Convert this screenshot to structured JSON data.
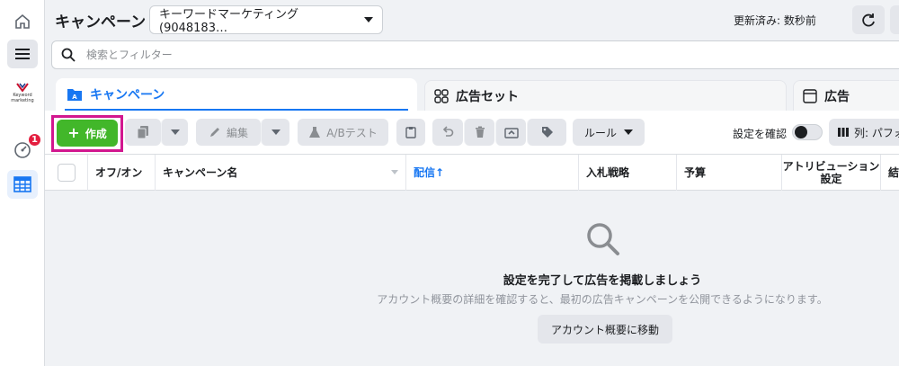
{
  "header": {
    "title": "キャンペーン",
    "account_select": "キーワードマーケティング (9048183…",
    "updated": "更新済み: 数秒前"
  },
  "search": {
    "placeholder": "検索とフィルター"
  },
  "rail": {
    "logo_text_1": "Keyword",
    "logo_text_2": "marketing",
    "notification_count": "1"
  },
  "tabs": [
    {
      "label": "キャンペーン",
      "icon": "folder-icon",
      "active": true
    },
    {
      "label": "広告セット",
      "icon": "grid-icon",
      "active": false
    },
    {
      "label": "広告",
      "icon": "ad-window-icon",
      "active": false
    }
  ],
  "toolbar": {
    "create_label": "作成",
    "edit_label": "編集",
    "ab_test_label": "A/Bテスト",
    "rules_label": "ルール",
    "verify_label": "設定を確認",
    "columns_label": "列: パフォ"
  },
  "table": {
    "columns": [
      "オフ/オン",
      "キャンペーン名",
      "配信↑",
      "入札戦略",
      "予算",
      "アトリビューション設定",
      "結"
    ]
  },
  "empty_state": {
    "title": "設定を完了して広告を掲載しましょう",
    "subtitle": "アカウント概要の詳細を確認すると、最初の広告キャンペーンを公開できるようになります。",
    "button": "アカウント概要に移動"
  },
  "colors": {
    "accent": "#1877f2",
    "create": "#42b72a",
    "highlight": "#d2178f",
    "badge": "#e41e3f"
  }
}
